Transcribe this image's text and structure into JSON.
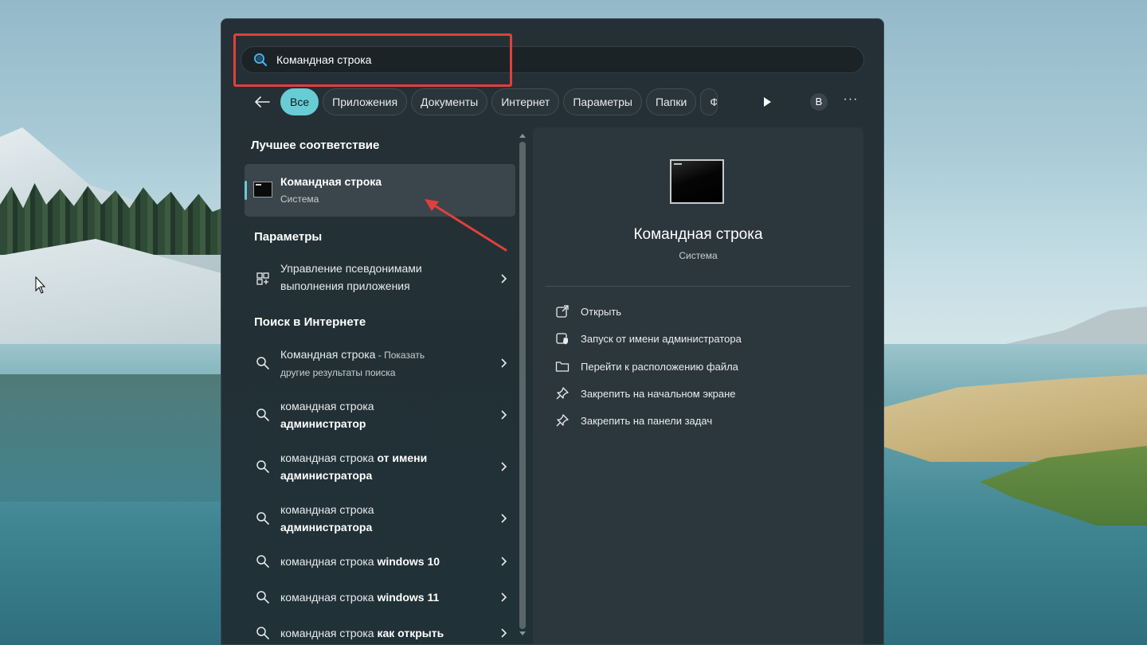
{
  "search": {
    "value": "Командная строка"
  },
  "filters": {
    "chips": [
      "Все",
      "Приложения",
      "Документы",
      "Интернет",
      "Параметры",
      "Папки",
      "Ф"
    ],
    "active_index": 0,
    "avatar_letter": "В"
  },
  "results": {
    "best_match_title": "Лучшее соответствие",
    "best_match": {
      "title": "Командная строка",
      "subtitle": "Система"
    },
    "settings_title": "Параметры",
    "settings_item": {
      "line1": "Управление псевдонимами",
      "line2": "выполнения приложения"
    },
    "web_title": "Поиск в Интернете",
    "web_items": [
      {
        "plain": "Командная строка",
        "suffix": " - Показать",
        "line2": "другие результаты поиска"
      },
      {
        "plain": "командная строка",
        "bold_line2": "администратор"
      },
      {
        "plain": "командная строка ",
        "bold": "от имени",
        "bold_line2": "администратора"
      },
      {
        "plain": "командная строка",
        "bold_line2": "администратора"
      },
      {
        "plain": "командная строка ",
        "bold": "windows 10"
      },
      {
        "plain": "командная строка ",
        "bold": "windows 11"
      },
      {
        "plain": "командная строка ",
        "bold": "как открыть"
      }
    ]
  },
  "preview": {
    "title": "Командная строка",
    "subtitle": "Система",
    "actions": [
      {
        "label": "Открыть",
        "icon": "open-external-icon"
      },
      {
        "label": "Запуск от имени администратора",
        "icon": "shield-admin-icon"
      },
      {
        "label": "Перейти к расположению файла",
        "icon": "folder-icon"
      },
      {
        "label": "Закрепить на начальном экране",
        "icon": "pin-icon"
      },
      {
        "label": "Закрепить на панели задач",
        "icon": "pin-icon"
      }
    ]
  },
  "colors": {
    "accent": "#68ccd5",
    "highlight": "#e0403a",
    "panel": "#253036"
  }
}
